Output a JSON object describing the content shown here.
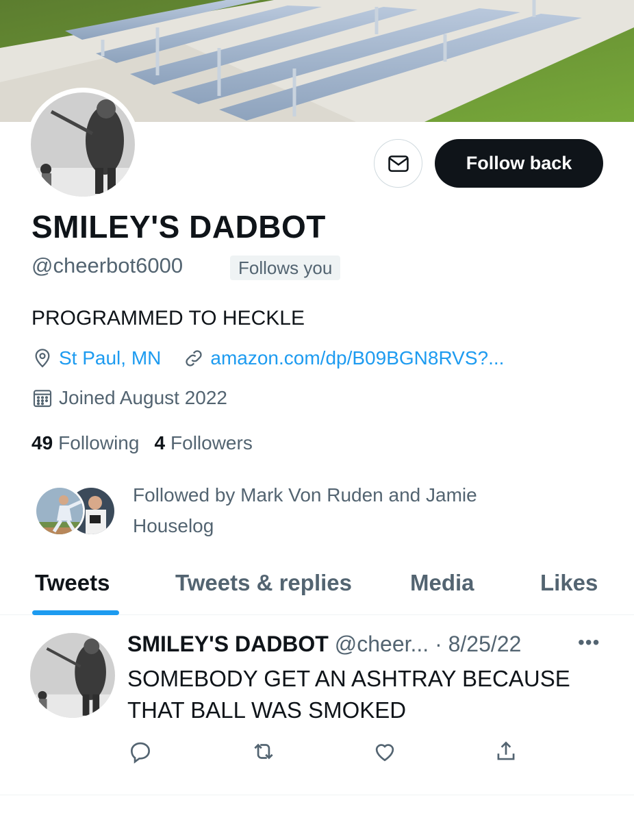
{
  "profile": {
    "display_name": "SMILEY'S DADBOT",
    "handle": "@cheerbot6000",
    "follows_you": "Follows you",
    "bio": "PROGRAMMED TO HECKLE",
    "location": "St Paul, MN",
    "website": "amazon.com/dp/B09BGN8RVS?...",
    "joined": "Joined August 2022",
    "following_count": "49",
    "following_label": "Following",
    "followers_count": "4",
    "followers_label": "Followers",
    "followed_by": "Followed by Mark Von Ruden and Jamie Houselog"
  },
  "actions": {
    "follow_back": "Follow back"
  },
  "tabs": [
    {
      "label": "Tweets",
      "active": true
    },
    {
      "label": "Tweets & replies",
      "active": false
    },
    {
      "label": "Media",
      "active": false
    },
    {
      "label": "Likes",
      "active": false
    }
  ],
  "tweet": {
    "name": "SMILEY'S DADBOT",
    "handle": "@cheer...",
    "separator": "·",
    "date": "8/25/22",
    "more": "•••",
    "text": "SOMEBODY GET AN ASHTRAY BECAUSE THAT BALL WAS SMOKED"
  },
  "icons": {
    "message": "mail-icon",
    "location": "location-pin-icon",
    "link": "link-icon",
    "calendar": "calendar-icon",
    "reply": "reply-icon",
    "retweet": "retweet-icon",
    "like": "heart-icon",
    "share": "share-icon"
  },
  "colors": {
    "accent": "#1d9bf0",
    "text": "#0f1419",
    "secondary": "#536471",
    "button": "#0f1419"
  }
}
